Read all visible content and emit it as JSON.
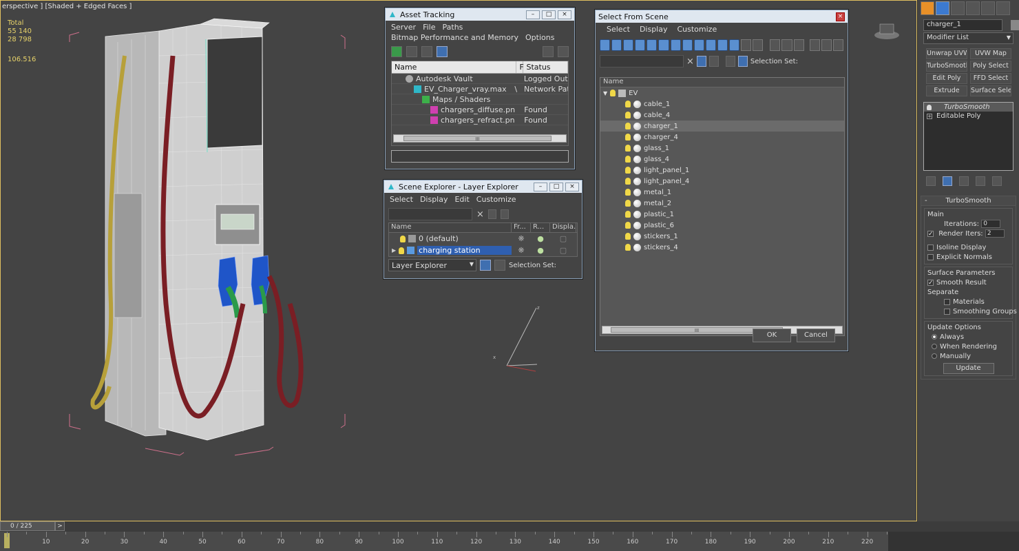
{
  "viewport": {
    "label": "erspective ] [Shaded + Edged Faces ]",
    "stats": {
      "title": "Total",
      "polys": "55 140",
      "verts": "28 798"
    },
    "fps": "106.516"
  },
  "asset_tracking": {
    "title": "Asset Tracking",
    "menu": [
      "Server",
      "File",
      "Paths",
      "Bitmap Performance and Memory",
      "Options"
    ],
    "columns": {
      "name": "Name",
      "f": "F",
      "status": "Status"
    },
    "rows": [
      {
        "name": "Autodesk Vault",
        "f": "",
        "status": "Logged Out ...",
        "icon": "vault-icon"
      },
      {
        "name": "EV_Charger_vray.max",
        "f": "\\",
        "status": "Network Path",
        "icon": "max-file-icon"
      },
      {
        "name": "Maps / Shaders",
        "f": "",
        "status": "",
        "icon": "maps-icon"
      },
      {
        "name": "chargers_diffuse.png",
        "f": "",
        "status": "Found",
        "icon": "png-icon"
      },
      {
        "name": "chargers_refract.png",
        "f": "",
        "status": "Found",
        "icon": "png-icon"
      }
    ],
    "scroll_label": "III"
  },
  "scene_explorer": {
    "title": "Scene Explorer - Layer Explorer",
    "menu": [
      "Select",
      "Display",
      "Edit",
      "Customize"
    ],
    "columns": {
      "name": "Name",
      "fr": "Fr...",
      "r": "R...",
      "display": "Displa..."
    },
    "rows": [
      {
        "name": "0 (default)",
        "selected": false
      },
      {
        "name": "charging station",
        "selected": true
      }
    ],
    "explorer_type": "Layer Explorer",
    "selection_set": "Selection Set:"
  },
  "select_from_scene": {
    "title": "Select From Scene",
    "menu": [
      "Select",
      "Display",
      "Customize"
    ],
    "selection_set": "Selection Set:",
    "column": "Name",
    "root": "EV",
    "items": [
      "cable_1",
      "cable_4",
      "charger_1",
      "charger_4",
      "glass_1",
      "glass_4",
      "light_panel_1",
      "light_panel_4",
      "metal_1",
      "metal_2",
      "plastic_1",
      "plastic_6",
      "stickers_1",
      "stickers_4"
    ],
    "selected_item": "charger_1",
    "scroll_label": "III",
    "ok": "OK",
    "cancel": "Cancel"
  },
  "command_panel": {
    "object_name": "charger_1",
    "modifier_list": "Modifier List",
    "buttons": [
      "Unwrap UVW",
      "UVW Map",
      "TurboSmooth",
      "Poly Select",
      "Edit Poly",
      "FFD Select",
      "Extrude",
      "Surface Select"
    ],
    "stack": [
      "TurboSmooth",
      "Editable Poly"
    ],
    "rollout_title": "TurboSmooth",
    "main_label": "Main",
    "iterations_label": "Iterations:",
    "iterations_value": "0",
    "render_iters_label": "Render Iters:",
    "render_iters_value": "2",
    "isoline": "Isoline Display",
    "explicit_normals": "Explicit Normals",
    "surface_params": "Surface Parameters",
    "smooth_result": "Smooth Result",
    "separate": "Separate",
    "materials": "Materials",
    "smoothing_groups": "Smoothing Groups",
    "update_options": "Update Options",
    "always": "Always",
    "when_rendering": "When Rendering",
    "manually": "Manually",
    "update_btn": "Update"
  },
  "timeline": {
    "frame": "0 / 225",
    "next": ">",
    "ticks": [
      "10",
      "20",
      "30",
      "40",
      "50",
      "60",
      "70",
      "80",
      "90",
      "100",
      "110",
      "120",
      "130",
      "140",
      "150",
      "160",
      "170",
      "180",
      "190",
      "200",
      "210",
      "220"
    ]
  },
  "colors": {
    "accent": "#2f5fb0",
    "viewport_bg": "#444444",
    "stats": "#e8d36a"
  }
}
